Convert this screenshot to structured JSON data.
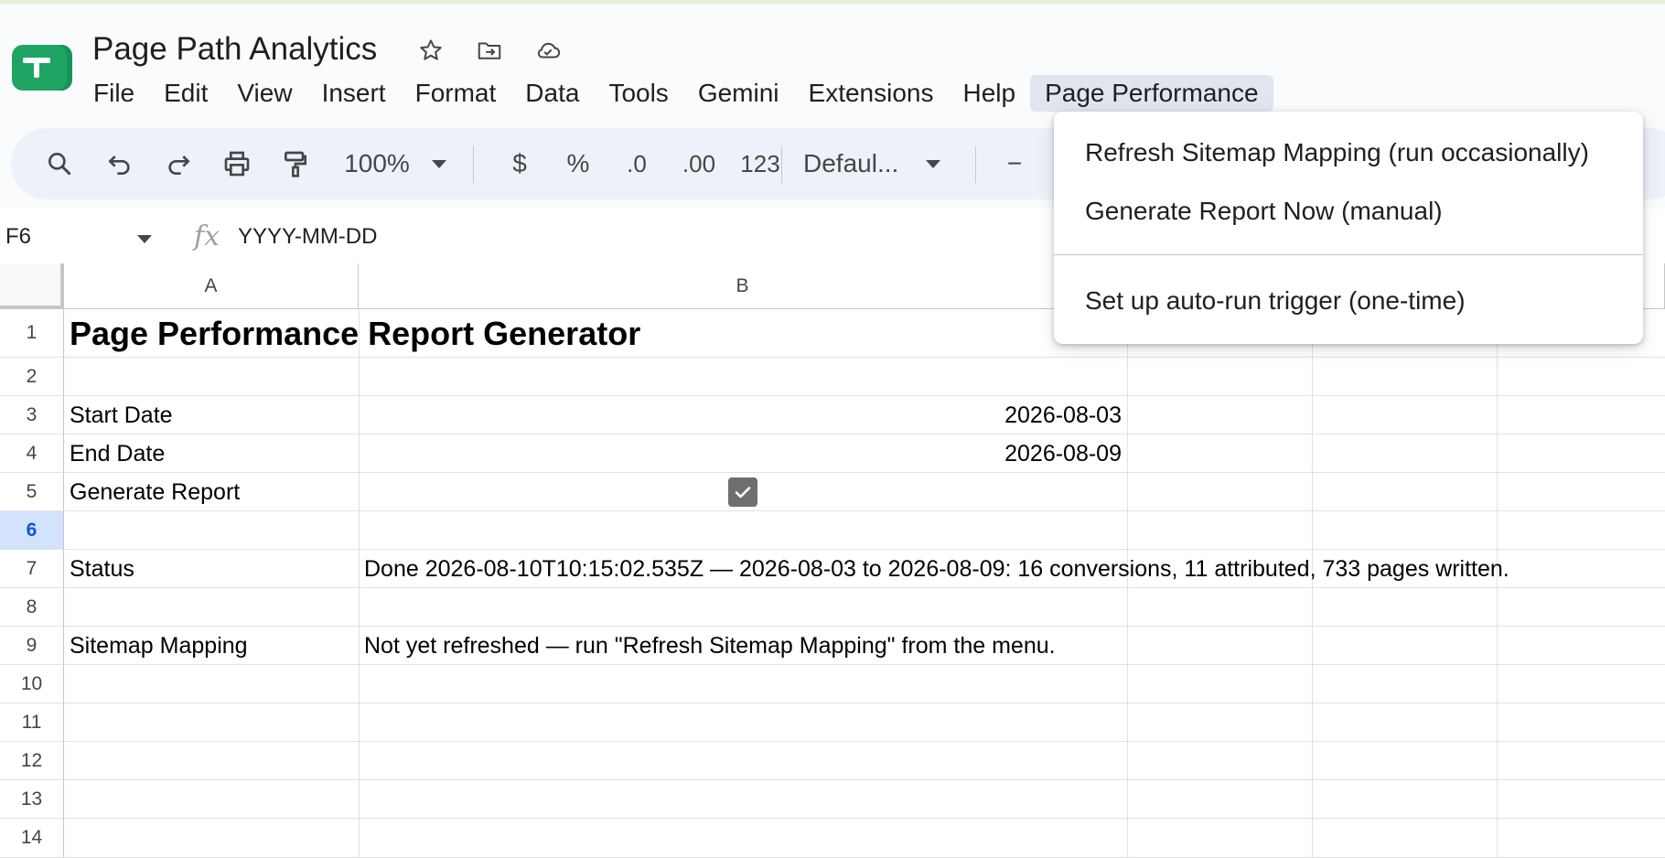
{
  "app": {
    "title": "Page Path Analytics",
    "icons": [
      "star-icon",
      "move-to-folder-icon",
      "cloud-saved-icon"
    ]
  },
  "menu": {
    "items": [
      "File",
      "Edit",
      "View",
      "Insert",
      "Format",
      "Data",
      "Tools",
      "Gemini",
      "Extensions",
      "Help",
      "Page Performance"
    ],
    "active": "Page Performance"
  },
  "toolbar": {
    "zoom": "100%",
    "currency": "$",
    "percent": "%",
    "decrease_decimal": ".0",
    "increase_decimal": ".00",
    "number_format": "123",
    "font": "Defaul...",
    "minus": "−"
  },
  "formula_bar": {
    "cell_ref": "F6",
    "fx": "fx",
    "value": "YYYY-MM-DD"
  },
  "columns": [
    "A",
    "B"
  ],
  "rows": [
    "1",
    "2",
    "3",
    "4",
    "5",
    "6",
    "7",
    "8",
    "9",
    "10",
    "11",
    "12",
    "13",
    "14"
  ],
  "selected_row": "6",
  "cells": {
    "a1": "Page Performance Report Generator",
    "a3": "Start Date",
    "b3": "2026-08-03",
    "a4": "End Date",
    "b4": "2026-08-09",
    "a5": "Generate Report",
    "b5_checked": true,
    "a7": "Status",
    "b7": "Done 2026-08-10T10:15:02.535Z — 2026-08-03 to 2026-08-09: 16 conversions, 11 attributed, 733 pages written.",
    "a9": "Sitemap Mapping",
    "b9": "Not yet refreshed — run \"Refresh Sitemap Mapping\" from the menu."
  },
  "dropdown": {
    "items": [
      "Refresh Sitemap Mapping (run occasionally)",
      "Generate Report Now (manual)",
      "Set up auto-run trigger (one-time)"
    ]
  },
  "colors": {
    "app_icon": "#1fa463",
    "toolbar_bg": "#edf2fa",
    "selected_row_bg": "#d3e3fd",
    "selected_row_text": "#0b57d0",
    "checkbox": "#6f6f6f"
  }
}
